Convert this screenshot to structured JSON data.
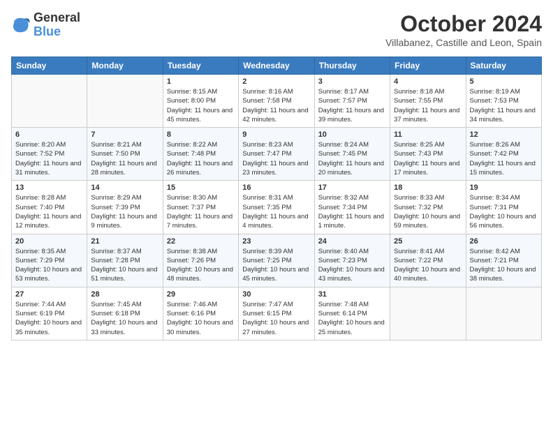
{
  "header": {
    "logo_line1": "General",
    "logo_line2": "Blue",
    "title": "October 2024",
    "subtitle": "Villabanez, Castille and Leon, Spain"
  },
  "days_of_week": [
    "Sunday",
    "Monday",
    "Tuesday",
    "Wednesday",
    "Thursday",
    "Friday",
    "Saturday"
  ],
  "weeks": [
    [
      {
        "day": "",
        "info": ""
      },
      {
        "day": "",
        "info": ""
      },
      {
        "day": "1",
        "info": "Sunrise: 8:15 AM\nSunset: 8:00 PM\nDaylight: 11 hours and 45 minutes."
      },
      {
        "day": "2",
        "info": "Sunrise: 8:16 AM\nSunset: 7:58 PM\nDaylight: 11 hours and 42 minutes."
      },
      {
        "day": "3",
        "info": "Sunrise: 8:17 AM\nSunset: 7:57 PM\nDaylight: 11 hours and 39 minutes."
      },
      {
        "day": "4",
        "info": "Sunrise: 8:18 AM\nSunset: 7:55 PM\nDaylight: 11 hours and 37 minutes."
      },
      {
        "day": "5",
        "info": "Sunrise: 8:19 AM\nSunset: 7:53 PM\nDaylight: 11 hours and 34 minutes."
      }
    ],
    [
      {
        "day": "6",
        "info": "Sunrise: 8:20 AM\nSunset: 7:52 PM\nDaylight: 11 hours and 31 minutes."
      },
      {
        "day": "7",
        "info": "Sunrise: 8:21 AM\nSunset: 7:50 PM\nDaylight: 11 hours and 28 minutes."
      },
      {
        "day": "8",
        "info": "Sunrise: 8:22 AM\nSunset: 7:48 PM\nDaylight: 11 hours and 26 minutes."
      },
      {
        "day": "9",
        "info": "Sunrise: 8:23 AM\nSunset: 7:47 PM\nDaylight: 11 hours and 23 minutes."
      },
      {
        "day": "10",
        "info": "Sunrise: 8:24 AM\nSunset: 7:45 PM\nDaylight: 11 hours and 20 minutes."
      },
      {
        "day": "11",
        "info": "Sunrise: 8:25 AM\nSunset: 7:43 PM\nDaylight: 11 hours and 17 minutes."
      },
      {
        "day": "12",
        "info": "Sunrise: 8:26 AM\nSunset: 7:42 PM\nDaylight: 11 hours and 15 minutes."
      }
    ],
    [
      {
        "day": "13",
        "info": "Sunrise: 8:28 AM\nSunset: 7:40 PM\nDaylight: 11 hours and 12 minutes."
      },
      {
        "day": "14",
        "info": "Sunrise: 8:29 AM\nSunset: 7:39 PM\nDaylight: 11 hours and 9 minutes."
      },
      {
        "day": "15",
        "info": "Sunrise: 8:30 AM\nSunset: 7:37 PM\nDaylight: 11 hours and 7 minutes."
      },
      {
        "day": "16",
        "info": "Sunrise: 8:31 AM\nSunset: 7:35 PM\nDaylight: 11 hours and 4 minutes."
      },
      {
        "day": "17",
        "info": "Sunrise: 8:32 AM\nSunset: 7:34 PM\nDaylight: 11 hours and 1 minute."
      },
      {
        "day": "18",
        "info": "Sunrise: 8:33 AM\nSunset: 7:32 PM\nDaylight: 10 hours and 59 minutes."
      },
      {
        "day": "19",
        "info": "Sunrise: 8:34 AM\nSunset: 7:31 PM\nDaylight: 10 hours and 56 minutes."
      }
    ],
    [
      {
        "day": "20",
        "info": "Sunrise: 8:35 AM\nSunset: 7:29 PM\nDaylight: 10 hours and 53 minutes."
      },
      {
        "day": "21",
        "info": "Sunrise: 8:37 AM\nSunset: 7:28 PM\nDaylight: 10 hours and 51 minutes."
      },
      {
        "day": "22",
        "info": "Sunrise: 8:38 AM\nSunset: 7:26 PM\nDaylight: 10 hours and 48 minutes."
      },
      {
        "day": "23",
        "info": "Sunrise: 8:39 AM\nSunset: 7:25 PM\nDaylight: 10 hours and 45 minutes."
      },
      {
        "day": "24",
        "info": "Sunrise: 8:40 AM\nSunset: 7:23 PM\nDaylight: 10 hours and 43 minutes."
      },
      {
        "day": "25",
        "info": "Sunrise: 8:41 AM\nSunset: 7:22 PM\nDaylight: 10 hours and 40 minutes."
      },
      {
        "day": "26",
        "info": "Sunrise: 8:42 AM\nSunset: 7:21 PM\nDaylight: 10 hours and 38 minutes."
      }
    ],
    [
      {
        "day": "27",
        "info": "Sunrise: 7:44 AM\nSunset: 6:19 PM\nDaylight: 10 hours and 35 minutes."
      },
      {
        "day": "28",
        "info": "Sunrise: 7:45 AM\nSunset: 6:18 PM\nDaylight: 10 hours and 33 minutes."
      },
      {
        "day": "29",
        "info": "Sunrise: 7:46 AM\nSunset: 6:16 PM\nDaylight: 10 hours and 30 minutes."
      },
      {
        "day": "30",
        "info": "Sunrise: 7:47 AM\nSunset: 6:15 PM\nDaylight: 10 hours and 27 minutes."
      },
      {
        "day": "31",
        "info": "Sunrise: 7:48 AM\nSunset: 6:14 PM\nDaylight: 10 hours and 25 minutes."
      },
      {
        "day": "",
        "info": ""
      },
      {
        "day": "",
        "info": ""
      }
    ]
  ]
}
